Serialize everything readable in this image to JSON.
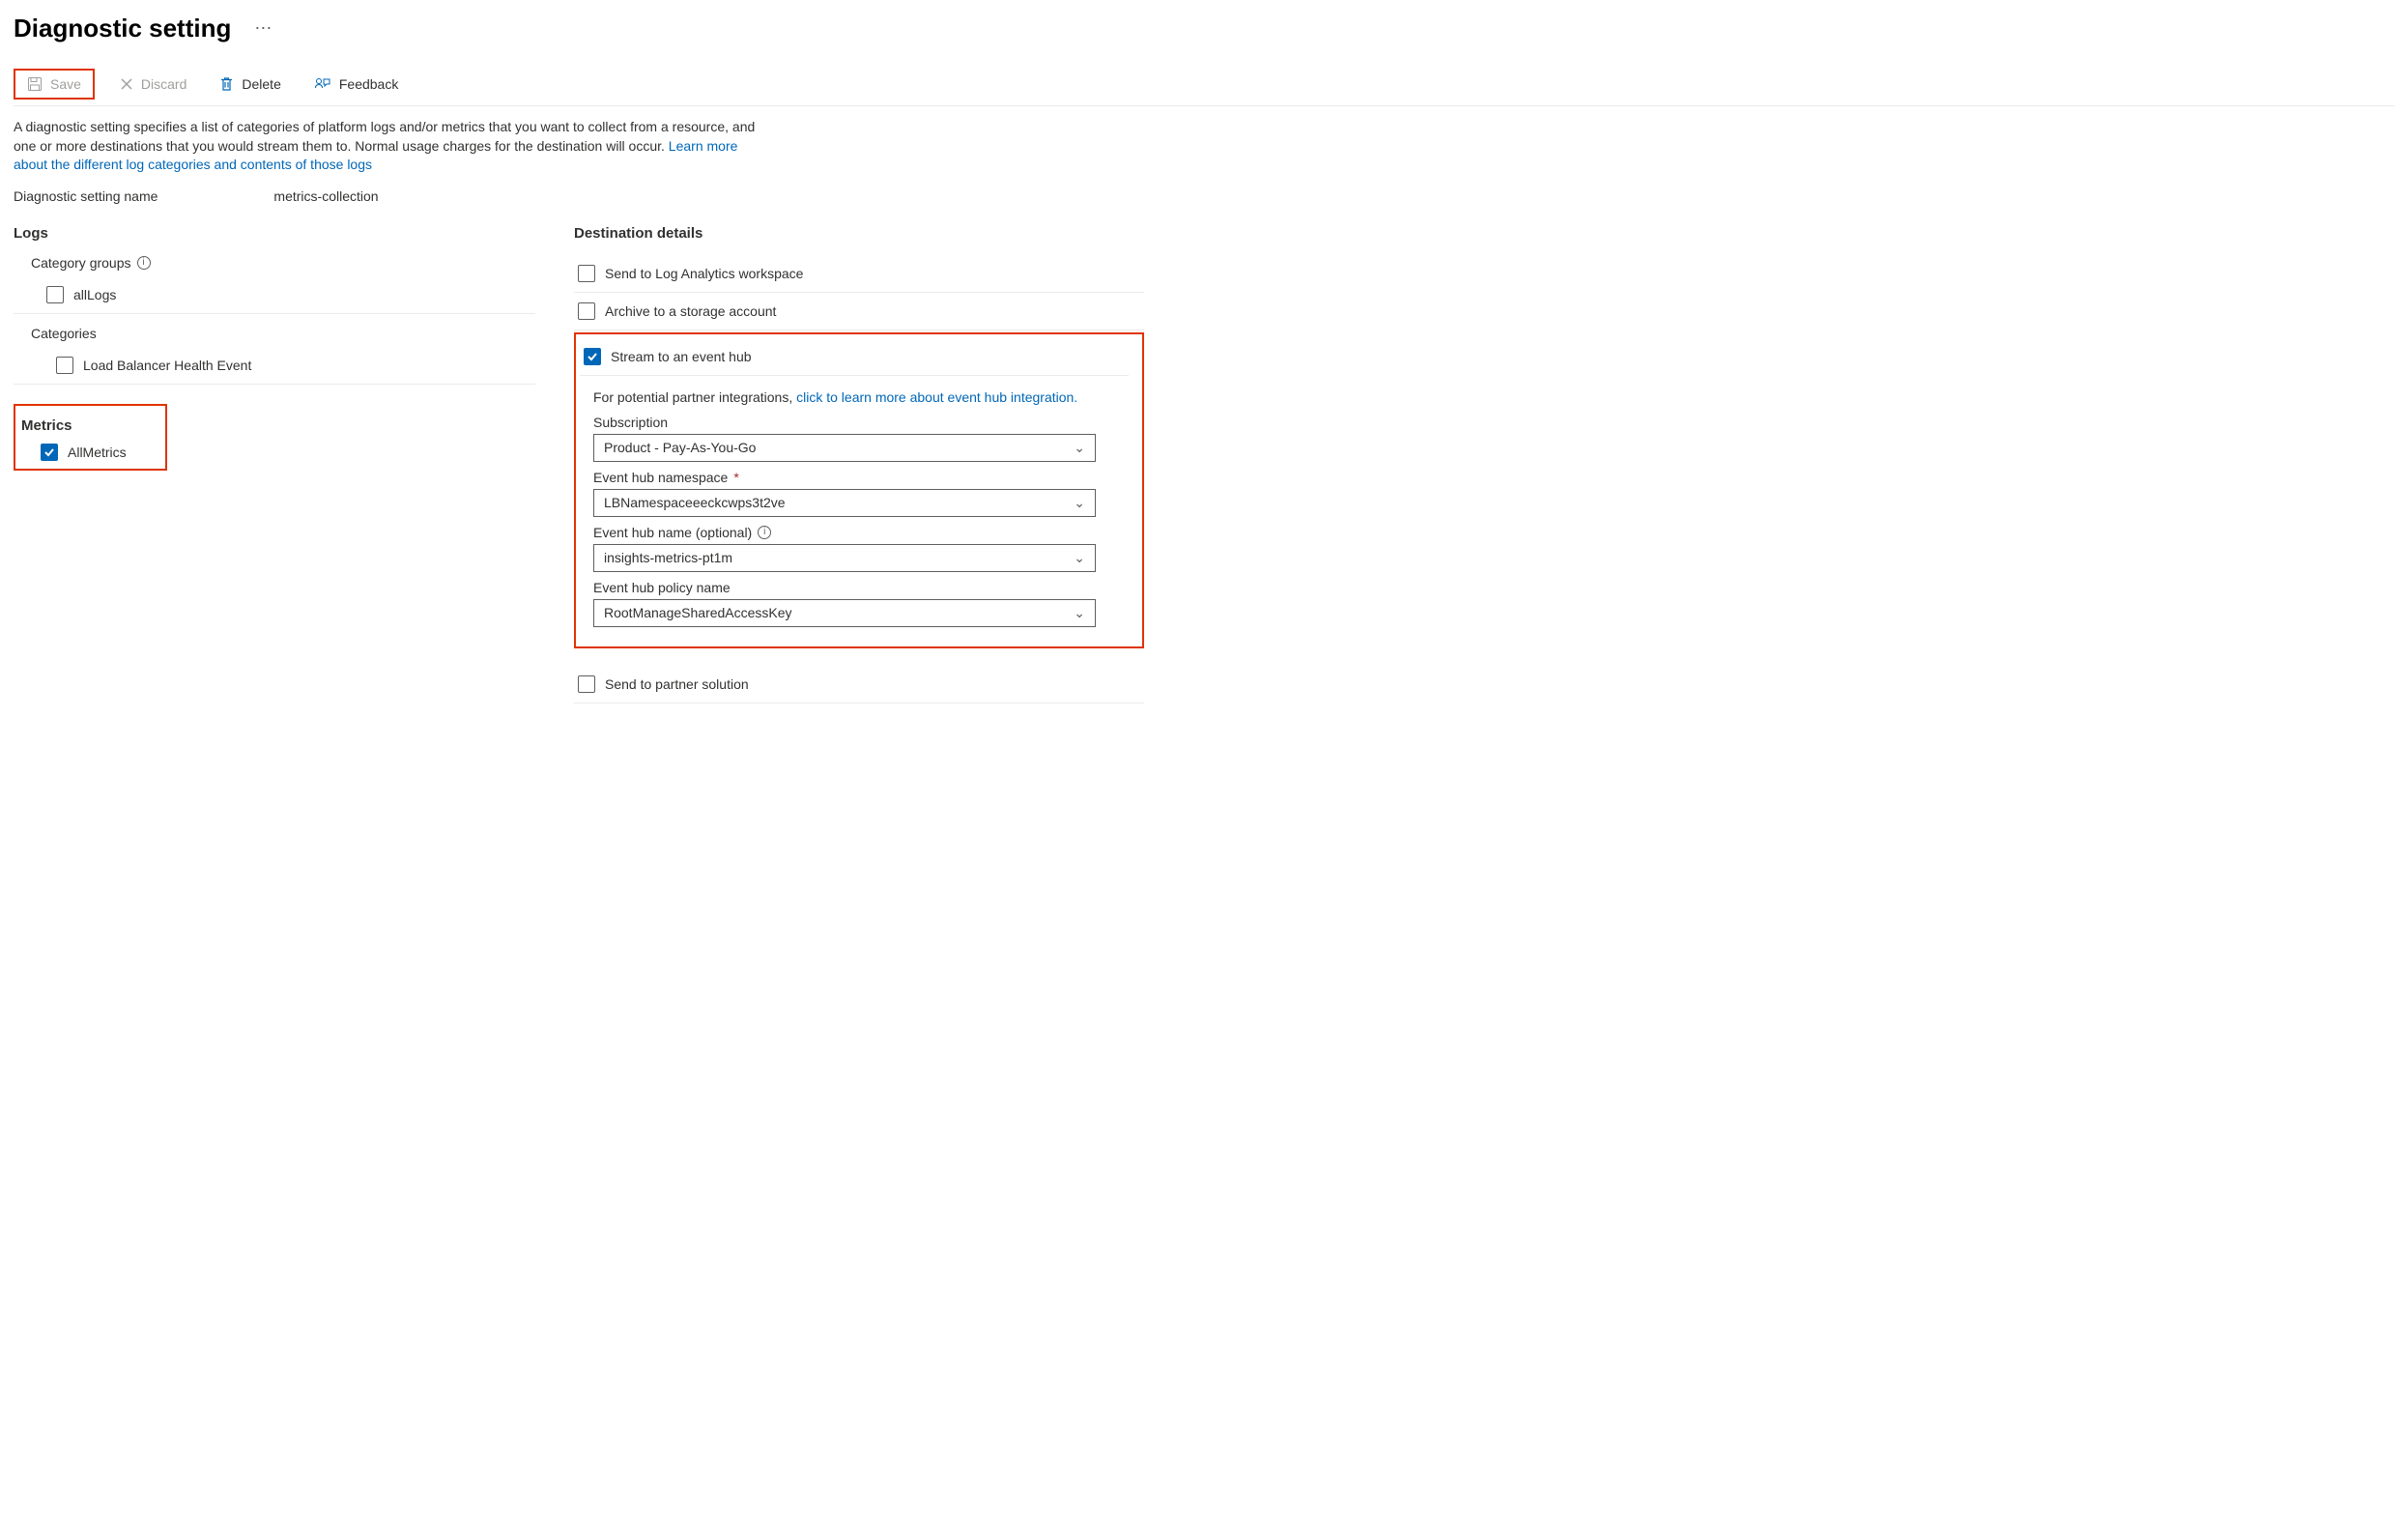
{
  "page": {
    "title": "Diagnostic setting"
  },
  "toolbar": {
    "save": "Save",
    "discard": "Discard",
    "delete": "Delete",
    "feedback": "Feedback"
  },
  "intro": {
    "text": "A diagnostic setting specifies a list of categories of platform logs and/or metrics that you want to collect from a resource, and one or more destinations that you would stream them to. Normal usage charges for the destination will occur. ",
    "link": "Learn more about the different log categories and contents of those logs"
  },
  "settingName": {
    "label": "Diagnostic setting name",
    "value": "metrics-collection"
  },
  "left": {
    "logsTitle": "Logs",
    "categoryGroupsTitle": "Category groups",
    "allLogs": "allLogs",
    "categoriesTitle": "Categories",
    "lbHealthEvent": "Load Balancer Health Event",
    "metricsTitle": "Metrics",
    "allMetrics": "AllMetrics"
  },
  "right": {
    "title": "Destination details",
    "sendLogAnalytics": "Send to Log Analytics workspace",
    "archiveStorage": "Archive to a storage account",
    "streamEventHub": "Stream to an event hub",
    "sendPartner": "Send to partner solution",
    "eventhub": {
      "textPrefix": "For potential partner integrations, ",
      "textLink": "click to learn more about event hub integration.",
      "subscriptionLabel": "Subscription",
      "subscriptionValue": "Product - Pay-As-You-Go",
      "namespaceLabel": "Event hub namespace",
      "namespaceValue": "LBNamespaceeeckcwps3t2ve",
      "nameLabel": "Event hub name (optional)",
      "nameValue": "insights-metrics-pt1m",
      "policyLabel": "Event hub policy name",
      "policyValue": "RootManageSharedAccessKey"
    }
  }
}
